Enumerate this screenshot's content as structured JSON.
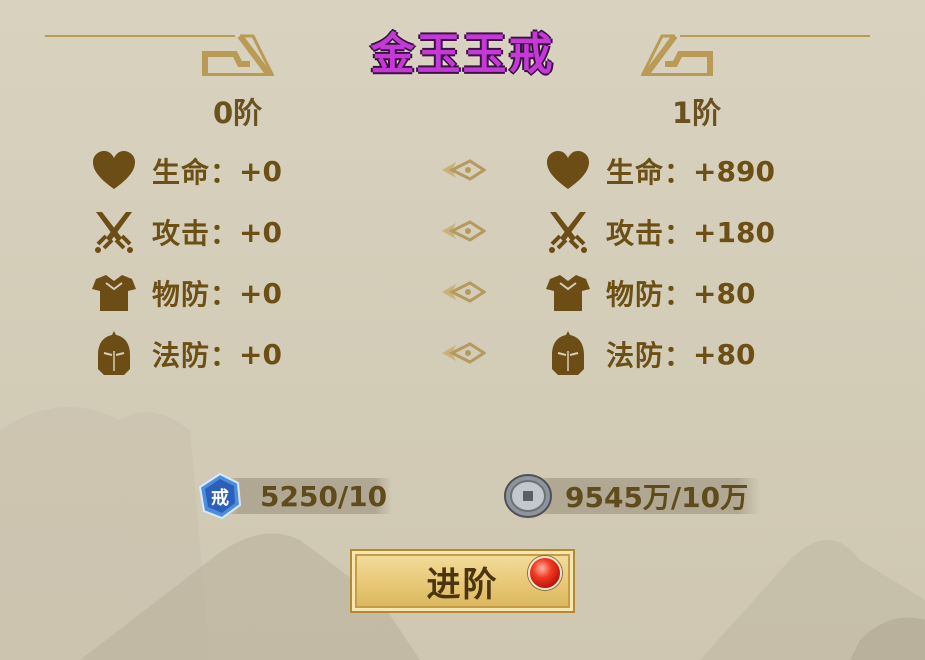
{
  "title": "金玉玉戒",
  "columns": {
    "left_header": "0阶",
    "right_header": "1阶"
  },
  "stats": [
    {
      "icon": "heart-icon",
      "label": "生命：",
      "current": "+0",
      "next": "+890"
    },
    {
      "icon": "crossed-swords-icon",
      "label": "攻击：",
      "current": "+0",
      "next": "+180"
    },
    {
      "icon": "armor-icon",
      "label": "物防：",
      "current": "+0",
      "next": "+80"
    },
    {
      "icon": "helmet-icon",
      "label": "法防：",
      "current": "+0",
      "next": "+80"
    }
  ],
  "resources": {
    "ring_material": {
      "icon": "ring-token-icon",
      "badge": "戒",
      "text": "5250/10"
    },
    "silver": {
      "icon": "silver-coin-icon",
      "text": "9545万/10万"
    }
  },
  "advance_button": {
    "label": "进阶",
    "has_notification": true
  },
  "colors": {
    "title": "#c53ad6",
    "text": "#6a5120",
    "button": "#e9ca79",
    "notify": "#e52a17"
  }
}
